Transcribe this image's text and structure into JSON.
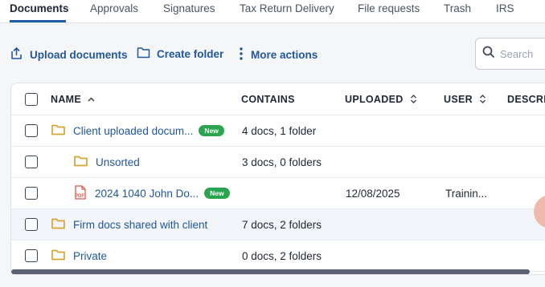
{
  "tabs": [
    {
      "label": "Documents",
      "active": true
    },
    {
      "label": "Approvals"
    },
    {
      "label": "Signatures"
    },
    {
      "label": "Tax Return Delivery"
    },
    {
      "label": "File requests"
    },
    {
      "label": "Trash"
    },
    {
      "label": "IRS"
    }
  ],
  "toolbar": {
    "upload_label": "Upload documents",
    "create_folder_label": "Create folder",
    "more_actions_label": "More actions",
    "search_placeholder": "Search"
  },
  "table": {
    "columns": {
      "name": "NAME",
      "contains": "CONTAINS",
      "uploaded": "UPLOADED",
      "user": "USER",
      "description": "DESCRI"
    },
    "rows": [
      {
        "name": "Client uploaded docum...",
        "badge": "New",
        "contains": "4 docs, 1 folder",
        "uploaded": "",
        "user": "",
        "icon": "folder-icon"
      },
      {
        "name": "Unsorted",
        "badge": "",
        "contains": "3 docs, 0 folders",
        "uploaded": "",
        "user": "",
        "icon": "folder-icon"
      },
      {
        "name": "2024 1040 John Do...",
        "badge": "New",
        "contains": "",
        "uploaded": "12/08/2025",
        "user": "Trainin...",
        "icon": "pdf-icon"
      },
      {
        "name": "Firm docs shared with client",
        "badge": "",
        "contains": "7 docs, 2 folders",
        "uploaded": "",
        "user": "",
        "icon": "folder-icon"
      },
      {
        "name": "Private",
        "badge": "",
        "contains": "0 docs, 2 folders",
        "uploaded": "",
        "user": "",
        "icon": "folder-icon"
      }
    ]
  },
  "icons": {
    "upload": "upload-icon",
    "folder": "folder-icon",
    "more": "more-vertical-icon",
    "search": "search-icon",
    "pdf": "pdf-file-icon"
  },
  "colors": {
    "link": "#22579a",
    "folder": "#d6a531",
    "badge": "#2aa44f",
    "pdf": "#e0574b"
  }
}
